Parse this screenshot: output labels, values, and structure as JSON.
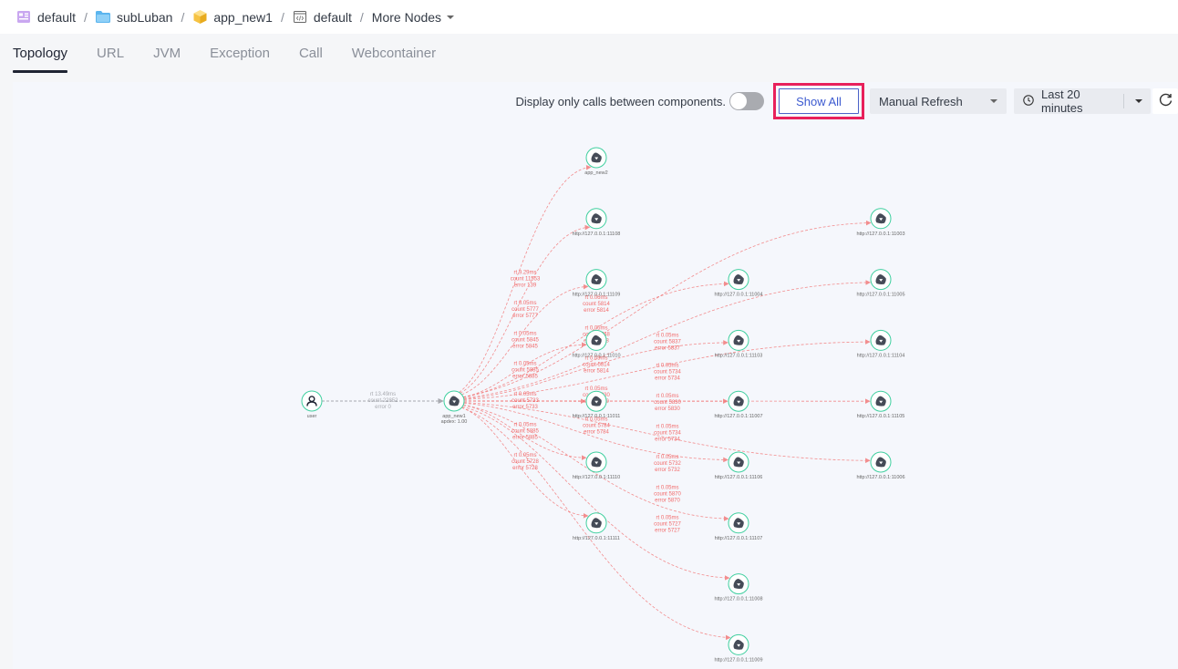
{
  "breadcrumb": [
    {
      "label": "default",
      "icon": "workspace-icon",
      "icon_color": "#b98de8"
    },
    {
      "label": "subLuban",
      "icon": "folder-icon",
      "icon_color": "#5bb5ee"
    },
    {
      "label": "app_new1",
      "icon": "cube-icon",
      "icon_color": "#f6c343"
    },
    {
      "label": "default",
      "icon": "code-window-icon",
      "icon_color": "#666666"
    },
    {
      "label": "More Nodes",
      "icon": "chevron-down-icon"
    }
  ],
  "tabs": [
    {
      "label": "Topology",
      "active": true
    },
    {
      "label": "URL",
      "active": false
    },
    {
      "label": "JVM",
      "active": false
    },
    {
      "label": "Exception",
      "active": false
    },
    {
      "label": "Call",
      "active": false
    },
    {
      "label": "Webcontainer",
      "active": false
    }
  ],
  "toolbar": {
    "toggle_label": "Display only calls between components.",
    "toggle_on": false,
    "show_all_label": "Show All",
    "refresh_mode": "Manual Refresh",
    "time_range": "Last 20 minutes"
  },
  "colors": {
    "accent": "#3d5bd0",
    "highlight": "#e8205b",
    "node_ring": "#3fcf9f",
    "edge_error": "#f26a6a",
    "edge_normal": "#a8aab0"
  },
  "topology": {
    "nodes": [
      {
        "id": "user",
        "label": "user",
        "type": "user",
        "col": 0,
        "row": 4
      },
      {
        "id": "app_new1",
        "label": "app_new1",
        "sublabel": "apdex: 1.00",
        "type": "service",
        "col": 1,
        "row": 4
      },
      {
        "id": "app_new2",
        "label": "app_new2",
        "type": "service",
        "col": 2,
        "row": 0
      },
      {
        "id": "n11108",
        "label": "http://127.0.0.1:11108",
        "type": "service",
        "col": 2,
        "row": 1
      },
      {
        "id": "n11109",
        "label": "http://127.0.0.1:11109",
        "type": "service",
        "col": 2,
        "row": 2
      },
      {
        "id": "n11010",
        "label": "http://127.0.0.1:11010",
        "type": "service",
        "col": 2,
        "row": 3
      },
      {
        "id": "n11011",
        "label": "http://127.0.0.1:11011",
        "type": "service",
        "col": 2,
        "row": 4
      },
      {
        "id": "n11110",
        "label": "http://127.0.0.1:11110",
        "type": "service",
        "col": 2,
        "row": 5
      },
      {
        "id": "n11111",
        "label": "http://127.0.0.1:11111",
        "type": "service",
        "col": 2,
        "row": 6
      },
      {
        "id": "n11004",
        "label": "http://127.0.0.1:11004",
        "type": "service",
        "col": 3,
        "row": 2
      },
      {
        "id": "n11103",
        "label": "http://127.0.0.1:11103",
        "type": "service",
        "col": 3,
        "row": 3
      },
      {
        "id": "n11007",
        "label": "http://127.0.0.1:11007",
        "type": "service",
        "col": 3,
        "row": 4
      },
      {
        "id": "n11106",
        "label": "http://127.0.0.1:11106",
        "type": "service",
        "col": 3,
        "row": 5
      },
      {
        "id": "n11107",
        "label": "http://127.0.0.1:11107",
        "type": "service",
        "col": 3,
        "row": 6
      },
      {
        "id": "n11008",
        "label": "http://127.0.0.1:11008",
        "type": "service",
        "col": 3,
        "row": 7
      },
      {
        "id": "n11009",
        "label": "http://127.0.0.1:11009",
        "type": "service",
        "col": 3,
        "row": 8
      },
      {
        "id": "n11003",
        "label": "http://127.0.0.1:11003",
        "type": "service",
        "col": 4,
        "row": 1
      },
      {
        "id": "n11005",
        "label": "http://127.0.0.1:11005",
        "type": "service",
        "col": 4,
        "row": 2
      },
      {
        "id": "n11104",
        "label": "http://127.0.0.1:11104",
        "type": "service",
        "col": 4,
        "row": 3
      },
      {
        "id": "n11105",
        "label": "http://127.0.0.1:11105",
        "type": "service",
        "col": 4,
        "row": 4
      },
      {
        "id": "n11006",
        "label": "http://127.0.0.1:11006",
        "type": "service",
        "col": 4,
        "row": 5
      }
    ],
    "edges": [
      {
        "from": "user",
        "to": "app_new1",
        "rt": "rt 13.49ms",
        "count": "count 22852",
        "error": "error 0",
        "status": "normal"
      },
      {
        "from": "app_new1",
        "to": "app_new2",
        "rt": "rt 9.29ms",
        "count": "count 11553",
        "error": "error 139",
        "status": "error"
      },
      {
        "from": "app_new1",
        "to": "n11108",
        "rt": "rt 0.05ms",
        "count": "count 5777",
        "error": "error 5777",
        "status": "error"
      },
      {
        "from": "app_new1",
        "to": "n11109",
        "rt": "rt 0.05ms",
        "count": "count 5845",
        "error": "error 5845",
        "status": "error"
      },
      {
        "from": "app_new1",
        "to": "n11010",
        "rt": "rt 0.05ms",
        "count": "count 5885",
        "error": "error 5885",
        "status": "error"
      },
      {
        "from": "app_new1",
        "to": "n11011",
        "rt": "rt 0.05ms",
        "count": "count 5733",
        "error": "error 5733",
        "status": "error"
      },
      {
        "from": "app_new1",
        "to": "n11110",
        "rt": "rt 0.05ms",
        "count": "count 5885",
        "error": "error 5885",
        "status": "error"
      },
      {
        "from": "app_new1",
        "to": "n11111",
        "rt": "rt 0.05ms",
        "count": "count 5728",
        "error": "error 5728",
        "status": "error"
      },
      {
        "from": "app_new1",
        "to": "n11004",
        "rt": "rt 0.05ms",
        "count": "count 5837",
        "error": "error 5837",
        "status": "error"
      },
      {
        "from": "app_new1",
        "to": "n11103",
        "rt": "rt 0.05ms",
        "count": "count 5734",
        "error": "error 5734",
        "status": "error"
      },
      {
        "from": "app_new1",
        "to": "n11007",
        "rt": "rt 0.05ms",
        "count": "count 5830",
        "error": "error 5830",
        "status": "error"
      },
      {
        "from": "app_new1",
        "to": "n11106",
        "rt": "rt 0.05ms",
        "count": "count 5734",
        "error": "error 5734",
        "status": "error"
      },
      {
        "from": "app_new1",
        "to": "n11107",
        "rt": "rt 0.05ms",
        "count": "count 5732",
        "error": "error 5732",
        "status": "error"
      },
      {
        "from": "app_new1",
        "to": "n11008",
        "rt": "rt 0.05ms",
        "count": "count 5870",
        "error": "error 5870",
        "status": "error"
      },
      {
        "from": "app_new1",
        "to": "n11009",
        "rt": "rt 0.05ms",
        "count": "count 5727",
        "error": "error 5727",
        "status": "error"
      },
      {
        "from": "app_new1",
        "to": "n11003",
        "rt": "rt 0.06ms",
        "count": "count 5814",
        "error": "error 5814",
        "status": "error"
      },
      {
        "from": "app_new1",
        "to": "n11005",
        "rt": "rt 0.05ms",
        "count": "count 5748",
        "error": "error 5748",
        "status": "error"
      },
      {
        "from": "app_new1",
        "to": "n11104",
        "rt": "rt 0.05ms",
        "count": "count 5814",
        "error": "error 5814",
        "status": "error"
      },
      {
        "from": "app_new1",
        "to": "n11105",
        "rt": "rt 0.05ms",
        "count": "count 5830",
        "error": "error 5830",
        "status": "error"
      },
      {
        "from": "app_new1",
        "to": "n11006",
        "rt": "rt 0.05ms",
        "count": "count 5784",
        "error": "error 5784",
        "status": "error"
      }
    ]
  }
}
